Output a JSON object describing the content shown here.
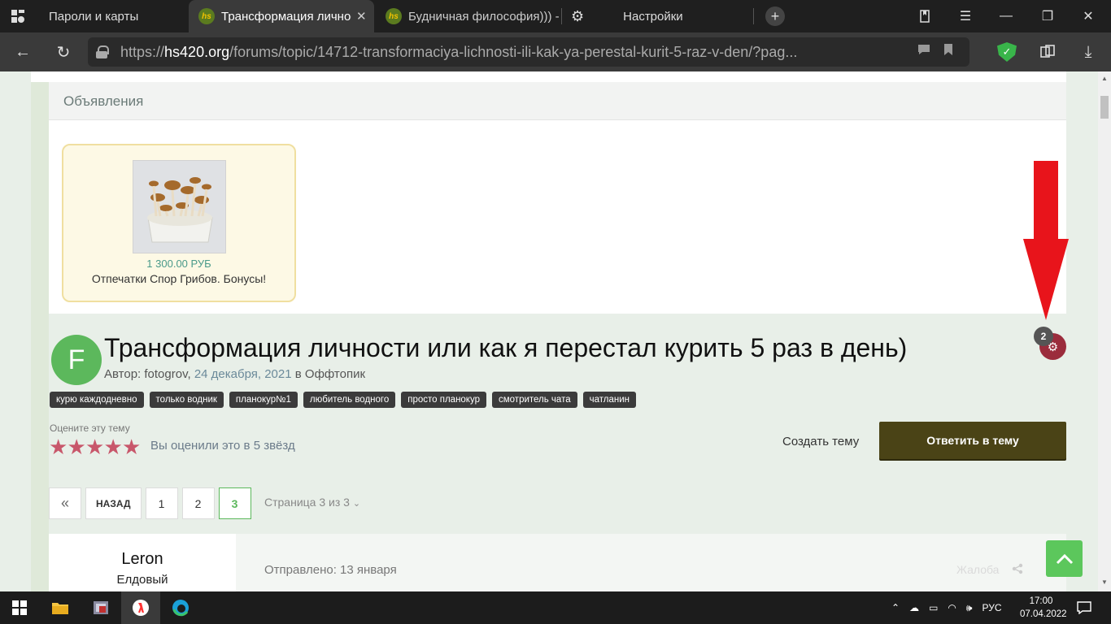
{
  "browser": {
    "tabs": [
      {
        "label": "Пароли и карты"
      },
      {
        "label": "Трансформация личнос"
      },
      {
        "label": "Будничная философия))) -"
      },
      {
        "label": "Настройки"
      }
    ],
    "url_prefix": "https://",
    "url_host": "hs420.org",
    "url_path": "/forums/topic/14712-transformaciya-lichnosti-ili-kak-ya-perestal-kurit-5-raz-v-den/?pag..."
  },
  "announcements": {
    "heading": "Объявления",
    "ad": {
      "price": "1 300.00 РУБ",
      "title": "Отпечатки Спор Грибов. Бонусы!"
    }
  },
  "topic": {
    "avatar_letter": "F",
    "title": "Трансформация личности или как я перестал курить 5 раз в день)",
    "author_prefix": "Автор: ",
    "author": "fotogrov",
    "date": "24 декабря, 2021",
    "in_word": " в ",
    "forum": "Оффтопик",
    "tags": [
      "курю каждодневно",
      "только водник",
      "планокур№1",
      "любитель водного",
      "просто планокур",
      "смотритель чата",
      "чатланин"
    ],
    "badge_count": "2"
  },
  "rating": {
    "label": "Оцените эту тему",
    "stars": 5,
    "note": "Вы оценили это в 5 звёзд"
  },
  "actions": {
    "create": "Создать тему",
    "reply": "Ответить в тему"
  },
  "pagination": {
    "first": "«",
    "back": "НАЗАД",
    "pages": [
      "1",
      "2",
      "3"
    ],
    "current": "3",
    "info": "Страница 3 из 3"
  },
  "post": {
    "author": "Leron",
    "rank": "Елдовый",
    "posted": "Отправлено: 13 января",
    "report": "Жалоба"
  },
  "taskbar": {
    "lang": "РУС",
    "time": "17:00",
    "date": "07.04.2022"
  },
  "colors": {
    "accent_green": "#5cb85c",
    "reply_button": "#4a4316",
    "star": "#c8576b",
    "arrow": "#e8141b"
  }
}
